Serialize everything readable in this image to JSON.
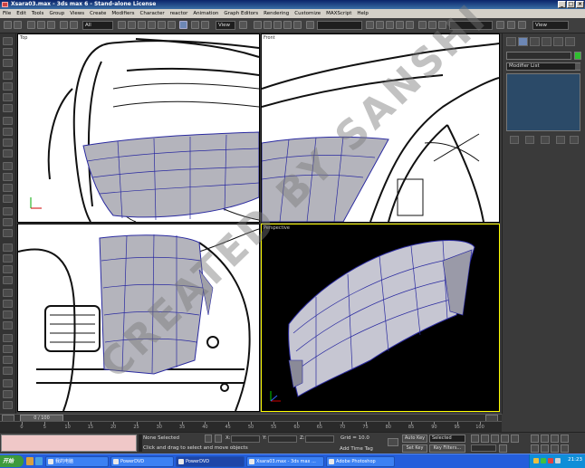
{
  "window": {
    "title": "Xsara03.max - 3ds max 6 - Stand-alone License",
    "minimize": "_",
    "maximize": "□",
    "close": "×"
  },
  "menu": [
    "File",
    "Edit",
    "Tools",
    "Group",
    "Views",
    "Create",
    "Modifiers",
    "Character",
    "reactor",
    "Animation",
    "Graph Editors",
    "Rendering",
    "Customize",
    "MAXScript",
    "Help"
  ],
  "toolbar": {
    "selection_filter": "All",
    "reference_coord": "View",
    "named_selection": "",
    "panel_coord": "View"
  },
  "viewports": {
    "top": {
      "label": "Top"
    },
    "front": {
      "label": "Front"
    },
    "left": {
      "label": ""
    },
    "perspective": {
      "label": "Perspective"
    }
  },
  "command_panel": {
    "name_field": "",
    "modifier_list": "Modifier List"
  },
  "time_slider": {
    "frame": "0 / 100"
  },
  "track_ticks": [
    {
      "value": 0,
      "label": "0"
    },
    {
      "value": 5,
      "label": "5"
    },
    {
      "value": 10,
      "label": "10"
    },
    {
      "value": 15,
      "label": "15"
    },
    {
      "value": 20,
      "label": "20"
    },
    {
      "value": 25,
      "label": "25"
    },
    {
      "value": 30,
      "label": "30"
    },
    {
      "value": 35,
      "label": "35"
    },
    {
      "value": 40,
      "label": "40"
    },
    {
      "value": 45,
      "label": "45"
    },
    {
      "value": 50,
      "label": "50"
    },
    {
      "value": 55,
      "label": "55"
    },
    {
      "value": 60,
      "label": "60"
    },
    {
      "value": 65,
      "label": "65"
    },
    {
      "value": 70,
      "label": "70"
    },
    {
      "value": 75,
      "label": "75"
    },
    {
      "value": 80,
      "label": "80"
    },
    {
      "value": 85,
      "label": "85"
    },
    {
      "value": 90,
      "label": "90"
    },
    {
      "value": 95,
      "label": "95"
    },
    {
      "value": 100,
      "label": "100"
    }
  ],
  "status": {
    "selection": "None Selected",
    "prompt": "Click and drag to select and move objects",
    "x_label": "X:",
    "y_label": "Y:",
    "z_label": "Z:",
    "grid": "Grid = 10.0",
    "add_time_tag": "Add Time Tag",
    "auto_key": "Auto Key",
    "set_key": "Set Key",
    "key_mode": "Selected",
    "key_filters": "Key Filters..."
  },
  "taskbar": {
    "start": "开始",
    "tasks": [
      {
        "label": "我的电脑",
        "active": false
      },
      {
        "label": "PowerDVD",
        "active": false
      },
      {
        "label": "PowerDVD",
        "active": true
      },
      {
        "label": "Xsara03.max - 3ds max ...",
        "active": false
      },
      {
        "label": "Adobe Photoshop",
        "active": false
      }
    ],
    "clock": "21:23"
  },
  "watermark": "CREATED BY SANSHI",
  "colors": {
    "title_gradient_start": "#0a246a",
    "viewport_border_active": "#ffff00",
    "mesh_wire": "#2a2aa0",
    "maxscript_listener": "#f0c8c8",
    "taskbar": "#245edb"
  }
}
